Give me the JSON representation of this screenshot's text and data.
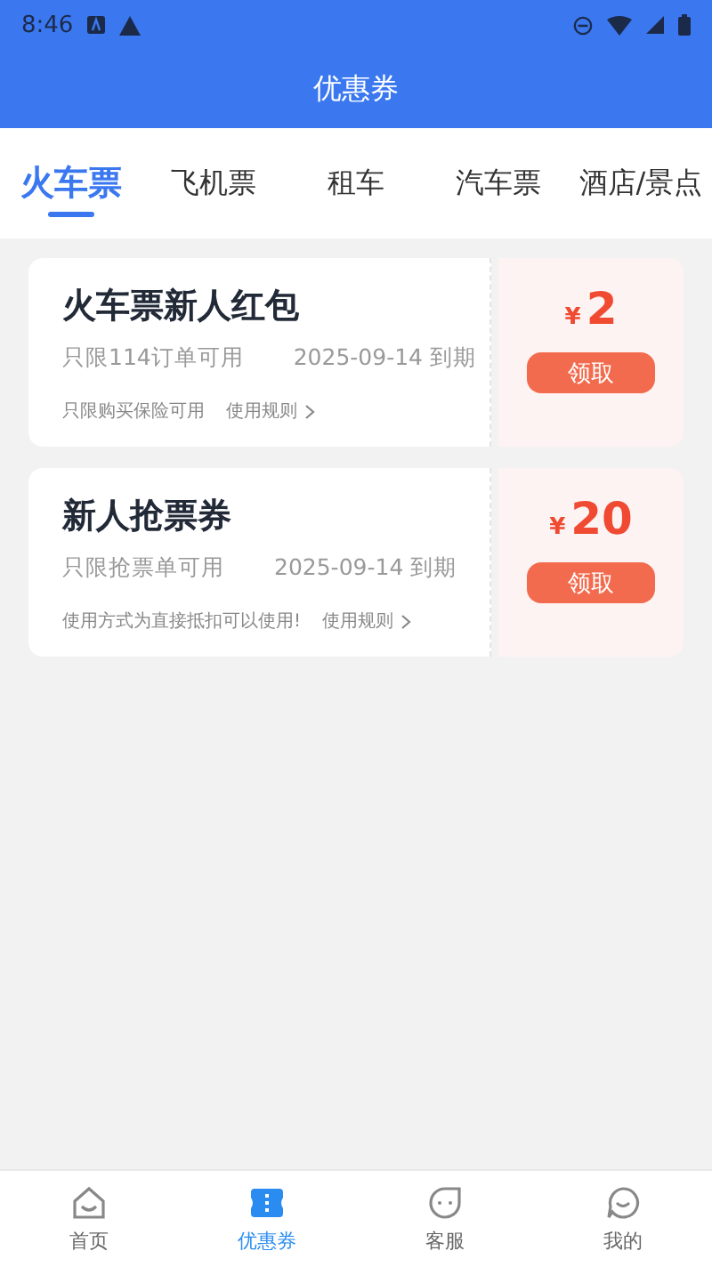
{
  "status_bar": {
    "time": "8:46"
  },
  "header": {
    "title": "优惠券"
  },
  "tabs": [
    {
      "label": "火车票",
      "selected": true
    },
    {
      "label": "飞机票",
      "selected": false
    },
    {
      "label": "租车",
      "selected": false
    },
    {
      "label": "汽车票",
      "selected": false
    },
    {
      "label": "酒店/景点",
      "selected": false
    }
  ],
  "coupons": [
    {
      "title": "火车票新人红包",
      "scope": "只限114订单可用",
      "expiry": "2025-09-14 到期",
      "note": "只限购买保险可用",
      "rules": "使用规则",
      "currency": "¥",
      "amount": "2",
      "button": "领取"
    },
    {
      "title": "新人抢票券",
      "scope": "只限抢票单可用",
      "expiry": "2025-09-14 到期",
      "note": "使用方式为直接抵扣可以使用!",
      "rules": "使用规则",
      "currency": "¥",
      "amount": "20",
      "button": "领取"
    }
  ],
  "nav": [
    {
      "kind": "home",
      "label": "首页",
      "selected": false
    },
    {
      "kind": "coupon",
      "label": "优惠券",
      "selected": true
    },
    {
      "kind": "service",
      "label": "客服",
      "selected": false
    },
    {
      "kind": "profile",
      "label": "我的",
      "selected": false
    }
  ]
}
